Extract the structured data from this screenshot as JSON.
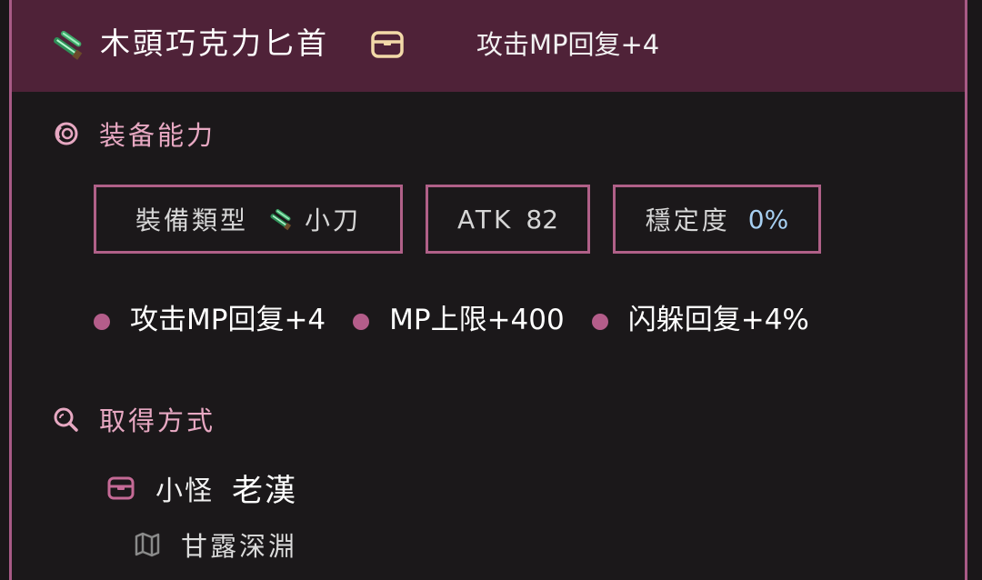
{
  "header": {
    "title": "木頭巧克力匕首",
    "effect": "攻击MP回复+4",
    "item_icon": "dagger-icon",
    "source_icon": "chest-icon"
  },
  "ability_section": {
    "heading": "装备能力",
    "icon": "swirl-icon",
    "stats": [
      {
        "label": "裝備類型",
        "value": "小刀",
        "icon": "dagger-icon"
      },
      {
        "label": "ATK",
        "value": "82"
      },
      {
        "label": "穩定度",
        "value": "0%"
      }
    ],
    "effects": [
      "攻击MP回复+4",
      "MP上限+400",
      "闪躲回复+4%"
    ]
  },
  "acquire_section": {
    "heading": "取得方式",
    "icon": "search-icon",
    "source": {
      "type": "小怪",
      "name": "老漢",
      "icon": "chest-icon"
    },
    "location": {
      "name": "甘露深淵",
      "icon": "map-icon"
    }
  },
  "colors": {
    "header_bg": "#4f2238",
    "accent": "#b06088",
    "heading_text": "#e7a8c2",
    "stat_blue": "#a7d0f2",
    "bg": "#1b181a"
  }
}
